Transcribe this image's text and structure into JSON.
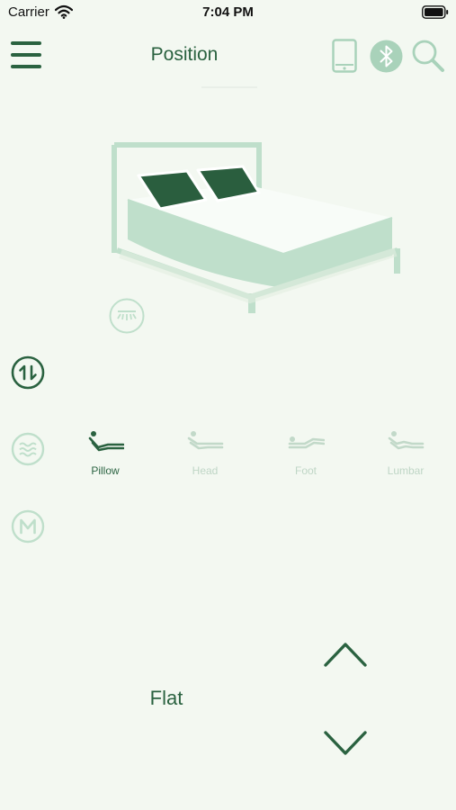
{
  "status_bar": {
    "carrier": "Carrier",
    "time": "7:04 PM"
  },
  "nav": {
    "title": "Position",
    "icons": [
      "menu-icon",
      "phone-icon",
      "bluetooth-icon",
      "search-icon"
    ]
  },
  "zones": {
    "active": "Pillow",
    "items": [
      {
        "label": "Pillow",
        "icon": "pillow-zone-icon"
      },
      {
        "label": "Head",
        "icon": "head-zone-icon"
      },
      {
        "label": "Foot",
        "icon": "foot-zone-icon"
      },
      {
        "label": "Lumbar",
        "icon": "lumbar-zone-icon"
      }
    ]
  },
  "modes": [
    "position-mode-icon",
    "massage-mode-icon",
    "memory-mode-icon"
  ],
  "preset": {
    "label": "Flat"
  },
  "colors": {
    "background": "#f3f8f1",
    "primary": "#2a6240",
    "light": "#bfdfcb",
    "inactive": "#c2d9c9"
  }
}
